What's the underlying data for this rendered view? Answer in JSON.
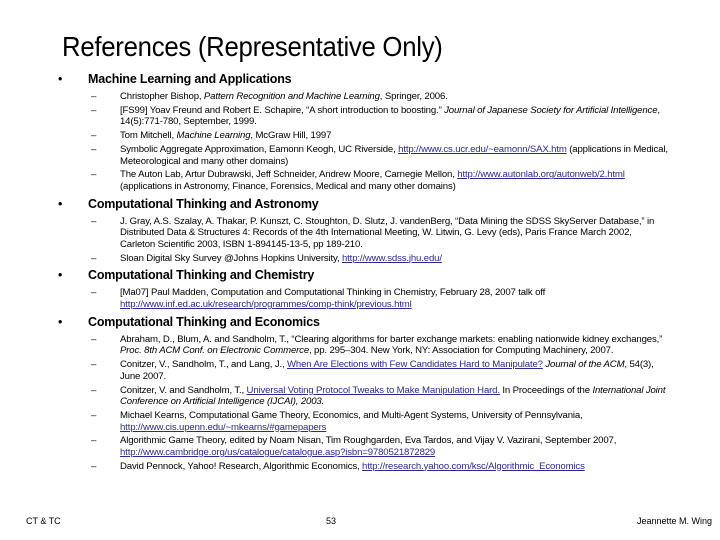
{
  "slide": {
    "title": "References (Representative Only)",
    "link_color": "#2b2b8f",
    "footer": {
      "left": "CT & TC",
      "center": "53",
      "right": "Jeannette M. Wing"
    }
  },
  "sections": [
    {
      "heading": "Machine Learning and Applications",
      "items": [
        {
          "parts": [
            {
              "t": "Christopher Bishop, "
            },
            {
              "t": "Pattern Recognition and Machine Learning",
              "style": "italic"
            },
            {
              "t": ", Springer, 2006."
            }
          ]
        },
        {
          "parts": [
            {
              "t": "[FS99] Yoav Freund and Robert E. Schapire, “A short introduction to boosting.” "
            },
            {
              "t": "Journal of Japanese Society for Artificial Intelligence",
              "style": "italic"
            },
            {
              "t": ", 14(5):771-780, September, 1999."
            }
          ]
        },
        {
          "parts": [
            {
              "t": "Tom Mitchell, "
            },
            {
              "t": "Machine Learning",
              "style": "italic"
            },
            {
              "t": ", McGraw Hill, 1997"
            }
          ]
        },
        {
          "parts": [
            {
              "t": "Symbolic Aggregate Approximation, Eamonn Keogh, UC Riverside, "
            },
            {
              "t": "http://www.cs.ucr.edu/~eamonn/SAX.htm",
              "style": "link"
            },
            {
              "t": " (applications in Medical, Meteorological and many other domains)"
            }
          ]
        },
        {
          "parts": [
            {
              "t": "The Auton Lab, Artur Dubrawski, Jeff Schneider, Andrew Moore, Carnegie Mellon, "
            },
            {
              "t": "http://www.autonlab.org/autonweb/2.html",
              "style": "link"
            },
            {
              "t": " (applications in Astronomy, Finance, Forensics, Medical and many other domains)"
            }
          ]
        }
      ]
    },
    {
      "heading": "Computational Thinking and Astronomy",
      "items": [
        {
          "parts": [
            {
              "t": "J. Gray, A.S. Szalay, A. Thakar, P. Kunszt, C. Stoughton, D. Slutz, J. vandenBerg, “Data Mining the SDSS SkyServer Database,” in Distributed Data & Structures 4: Records of the 4th International Meeting, W. Litwin, G. Levy (eds), Paris France March 2002, Carleton Scientific 2003, ISBN 1-894145-13-5, pp 189-210."
            }
          ]
        },
        {
          "parts": [
            {
              "t": "Sloan Digital Sky Survey @Johns Hopkins University, "
            },
            {
              "t": "http://www.sdss.jhu.edu/",
              "style": "link"
            }
          ]
        }
      ]
    },
    {
      "heading": "Computational Thinking and Chemistry",
      "items": [
        {
          "parts": [
            {
              "t": "[Ma07] Paul Madden, Computation and Computational Thinking in Chemistry, February 28, 2007 talk off "
            },
            {
              "t": "http://www.inf.ed.ac.uk/research/programmes/comp-think/previous.html",
              "style": "link"
            }
          ]
        }
      ]
    },
    {
      "heading": "Computational Thinking and Economics",
      "items": [
        {
          "parts": [
            {
              "t": "Abraham, D., Blum, A. and Sandholm, T., “Clearing algorithms for barter exchange markets: enabling nationwide kidney exchanges,” "
            },
            {
              "t": "Proc. 8th ACM Conf. on Electronic Commerce",
              "style": "italic"
            },
            {
              "t": ", pp. 295–304. New York, NY: Association for Computing Machinery, 2007."
            }
          ]
        },
        {
          "parts": [
            {
              "t": "Conitzer, V., Sandholm, T., and Lang, J., "
            },
            {
              "t": "When Are Elections with Few Candidates Hard to Manipulate?",
              "style": "link"
            },
            {
              "t": " "
            },
            {
              "t": "Journal of the ACM",
              "style": "italic"
            },
            {
              "t": ", 54(3), June 2007."
            }
          ]
        },
        {
          "parts": [
            {
              "t": "Conitzer, V. and Sandholm, T., "
            },
            {
              "t": "Universal Voting Protocol Tweaks to Make Manipulation Hard.",
              "style": "link"
            },
            {
              "t": " In Proceedings of the "
            },
            {
              "t": "International Joint Conference on Artificial Intelligence (IJCAI), 2003.",
              "style": "italic"
            }
          ]
        },
        {
          "parts": [
            {
              "t": "Michael Kearns, Computational Game Theory, Economics, and Multi-Agent Systems, University of Pennsylvania, "
            },
            {
              "t": "http://www.cis.upenn.edu/~mkearns/#gamepapers",
              "style": "link"
            }
          ]
        },
        {
          "parts": [
            {
              "t": "Algorithmic Game Theory, edited by Noam Nisan, Tim Roughgarden, Eva Tardos, and Vijay V. Vazirani, September 2007, "
            },
            {
              "t": "http://www.cambridge.org/us/catalogue/catalogue.asp?isbn=9780521872829",
              "style": "link"
            }
          ]
        },
        {
          "parts": [
            {
              "t": "David Pennock, Yahoo! Research, Algorithmic Economics, "
            },
            {
              "t": "http://research.yahoo.com/ksc/Algorithmic_Economics",
              "style": "link"
            }
          ]
        }
      ]
    }
  ]
}
